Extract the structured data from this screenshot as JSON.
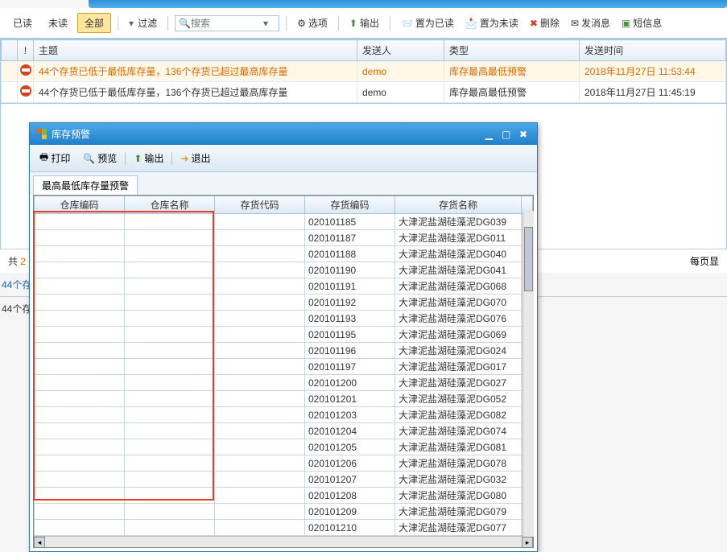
{
  "toolbar": {
    "read": "已读",
    "unread": "未读",
    "all": "全部",
    "filter": "过滤",
    "search_placeholder": "搜索",
    "options": "选项",
    "export": "输出",
    "mark_read": "置为已读",
    "mark_unread": "置为未读",
    "delete": "删除",
    "send_msg": "发消息",
    "sms": "短信息"
  },
  "columns": {
    "subject": "主题",
    "sender": "发送人",
    "type": "类型",
    "send_time": "发送时间"
  },
  "rows": [
    {
      "subject": "44个存货已低于最低库存量，136个存货已超过最高库存量",
      "sender": "demo",
      "type": "库存最高最低预警",
      "time": "2018年11月27日 11:53:44",
      "hl": true
    },
    {
      "subject": "44个存货已低于最低库存量，136个存货已超过最高库存量",
      "sender": "demo",
      "type": "库存最高最低预警",
      "time": "2018年11月27日 11:45:19",
      "hl": false
    }
  ],
  "pager": {
    "total_prefix": "共",
    "total_value": "2",
    "per_page": "每页显"
  },
  "preview": {
    "link": "44个存",
    "gray": "44个存"
  },
  "dialog": {
    "title": "库存预警",
    "print": "打印",
    "preview": "预览",
    "export": "输出",
    "exit": "退出",
    "tab": "最高最低库存量预警",
    "cols": {
      "c1": "仓库编码",
      "c2": "仓库名称",
      "c3": "存货代码",
      "c4": "存货编码",
      "c5": "存货名称"
    },
    "items": [
      {
        "code": "020101185",
        "name": "大津泥盐湖硅藻泥DG039"
      },
      {
        "code": "020101187",
        "name": "大津泥盐湖硅藻泥DG011"
      },
      {
        "code": "020101188",
        "name": "大津泥盐湖硅藻泥DG040"
      },
      {
        "code": "020101190",
        "name": "大津泥盐湖硅藻泥DG041"
      },
      {
        "code": "020101191",
        "name": "大津泥盐湖硅藻泥DG068"
      },
      {
        "code": "020101192",
        "name": "大津泥盐湖硅藻泥DG070"
      },
      {
        "code": "020101193",
        "name": "大津泥盐湖硅藻泥DG076"
      },
      {
        "code": "020101195",
        "name": "大津泥盐湖硅藻泥DG069"
      },
      {
        "code": "020101196",
        "name": "大津泥盐湖硅藻泥DG024"
      },
      {
        "code": "020101197",
        "name": "大津泥盐湖硅藻泥DG017"
      },
      {
        "code": "020101200",
        "name": "大津泥盐湖硅藻泥DG027"
      },
      {
        "code": "020101201",
        "name": "大津泥盐湖硅藻泥DG052"
      },
      {
        "code": "020101203",
        "name": "大津泥盐湖硅藻泥DG082"
      },
      {
        "code": "020101204",
        "name": "大津泥盐湖硅藻泥DG074"
      },
      {
        "code": "020101205",
        "name": "大津泥盐湖硅藻泥DG081"
      },
      {
        "code": "020101206",
        "name": "大津泥盐湖硅藻泥DG078"
      },
      {
        "code": "020101207",
        "name": "大津泥盐湖硅藻泥DG032"
      },
      {
        "code": "020101208",
        "name": "大津泥盐湖硅藻泥DG080"
      },
      {
        "code": "020101209",
        "name": "大津泥盐湖硅藻泥DG079"
      },
      {
        "code": "020101210",
        "name": "大津泥盐湖硅藻泥DG077"
      }
    ]
  }
}
